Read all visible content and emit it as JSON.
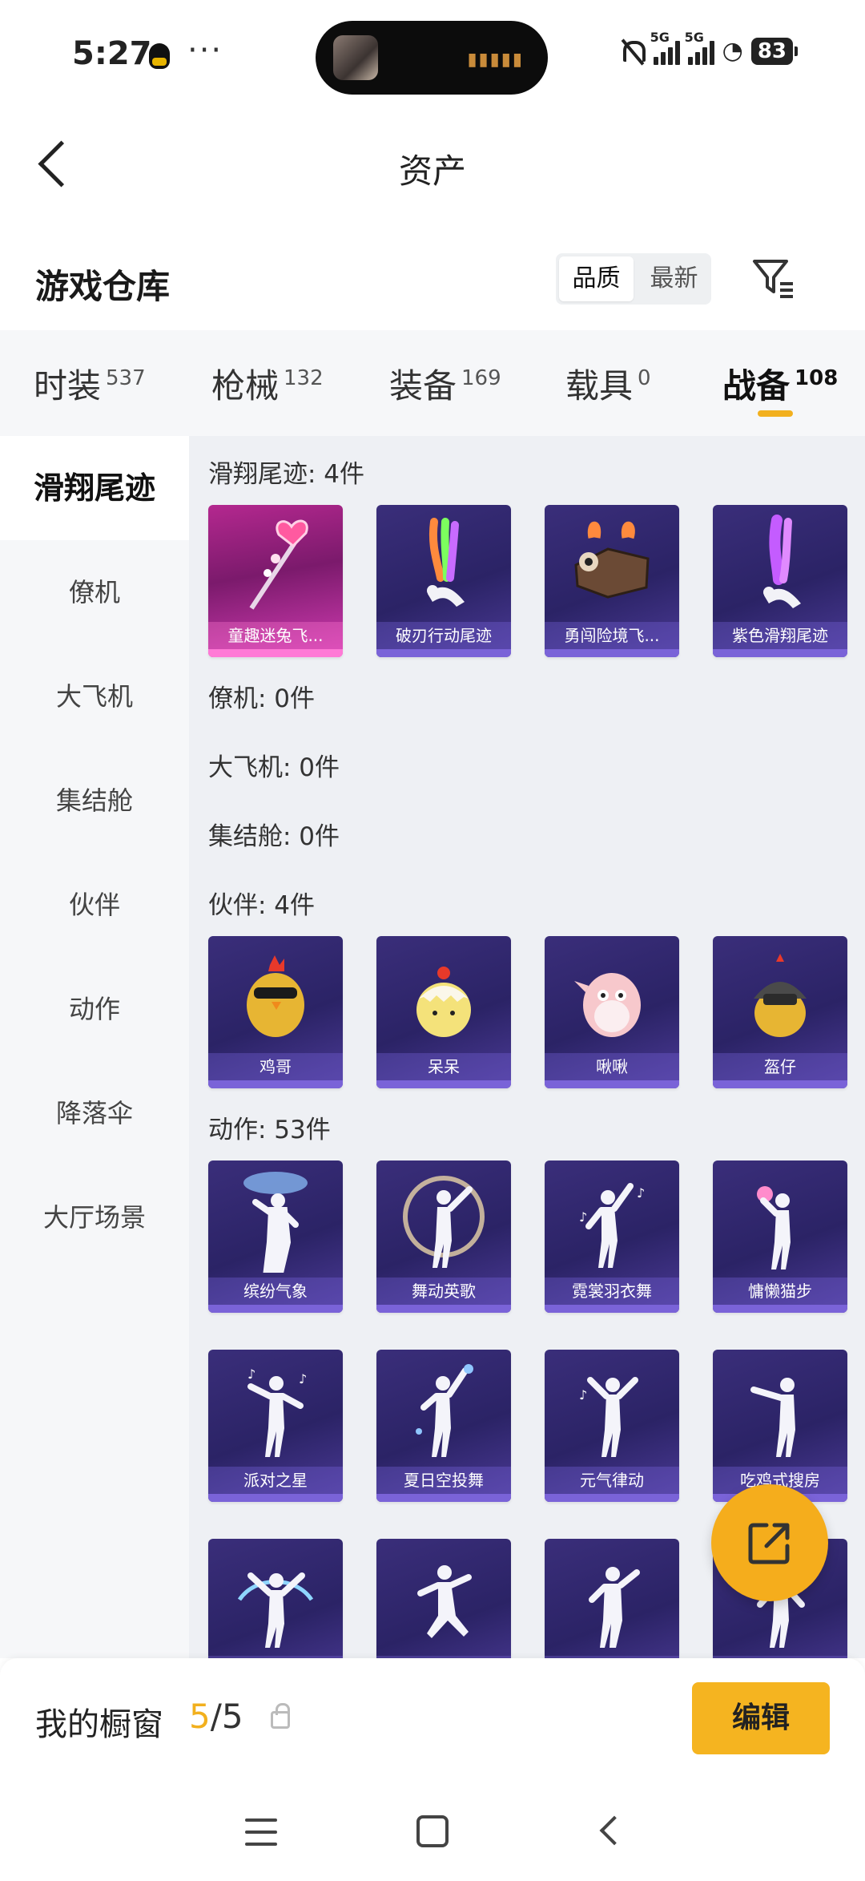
{
  "status_bar": {
    "time": "5:27",
    "more": "···",
    "signal_label": "5G",
    "battery": "83"
  },
  "header": {
    "title": "资产"
  },
  "warehouse": {
    "title": "游戏仓库",
    "sort_options": [
      "品质",
      "最新"
    ],
    "sort_active": "品质"
  },
  "tabs": [
    {
      "label": "时装",
      "count": "537"
    },
    {
      "label": "枪械",
      "count": "132"
    },
    {
      "label": "装备",
      "count": "169"
    },
    {
      "label": "载具",
      "count": "0"
    },
    {
      "label": "战备",
      "count": "108",
      "active": true
    }
  ],
  "side_nav": [
    "滑翔尾迹",
    "僚机",
    "大飞机",
    "集结舱",
    "伙伴",
    "动作",
    "降落伞",
    "大厅场景"
  ],
  "sections": {
    "glide": {
      "heading": "滑翔尾迹: 4件",
      "items": [
        "童趣迷兔飞...",
        "破刃行动尾迹",
        "勇闯险境飞...",
        "紫色滑翔尾迹"
      ]
    },
    "wingman": {
      "heading": "僚机: 0件"
    },
    "big_plane": {
      "heading": "大飞机: 0件"
    },
    "pod": {
      "heading": "集结舱: 0件"
    },
    "partner": {
      "heading": "伙伴: 4件",
      "items": [
        "鸡哥",
        "呆呆",
        "啾啾",
        "盔仔"
      ]
    },
    "emote": {
      "heading": "动作: 53件",
      "items": [
        "缤纷气象",
        "舞动英歌",
        "霓裳羽衣舞",
        "慵懒猫步",
        "派对之星",
        "夏日空投舞",
        "元气律动",
        "吃鸡式搜房",
        "",
        "",
        "",
        ""
      ]
    }
  },
  "bottom": {
    "label": "我的橱窗",
    "count_current": "5",
    "count_total": "/5",
    "edit": "编辑"
  },
  "colors": {
    "accent": "#f5b420",
    "card_bg": "#2b2366",
    "highlight_card": "#b4288f"
  }
}
